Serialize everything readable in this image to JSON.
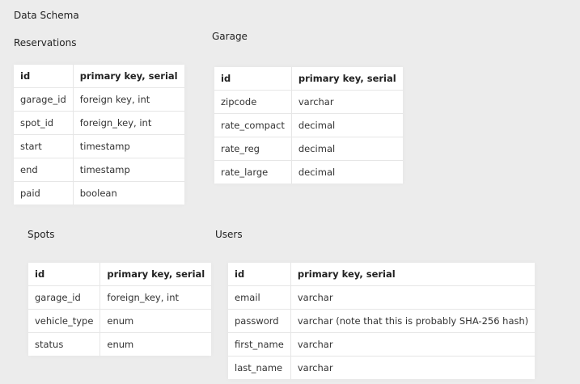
{
  "page_title": "Data Schema",
  "tables": {
    "reservations": {
      "title": "Reservations",
      "header": [
        "id",
        "primary key, serial"
      ],
      "rows": [
        [
          "garage_id",
          "foreign key, int"
        ],
        [
          "spot_id",
          "foreign_key, int"
        ],
        [
          "start",
          "timestamp"
        ],
        [
          "end",
          "timestamp"
        ],
        [
          "paid",
          "boolean"
        ]
      ]
    },
    "garage": {
      "title": "Garage",
      "header": [
        "id",
        "primary key, serial"
      ],
      "rows": [
        [
          "zipcode",
          "varchar"
        ],
        [
          "rate_compact",
          "decimal"
        ],
        [
          "rate_reg",
          "decimal"
        ],
        [
          "rate_large",
          "decimal"
        ]
      ]
    },
    "spots": {
      "title": "Spots",
      "header": [
        "id",
        "primary key, serial"
      ],
      "rows": [
        [
          "garage_id",
          "foreign_key, int"
        ],
        [
          "vehicle_type",
          "enum"
        ],
        [
          "status",
          "enum"
        ]
      ]
    },
    "users": {
      "title": "Users",
      "header": [
        "id",
        "primary key, serial"
      ],
      "rows": [
        [
          "email",
          "varchar"
        ],
        [
          "password",
          "varchar (note that this is probably SHA-256 hash)"
        ],
        [
          "first_name",
          "varchar"
        ],
        [
          "last_name",
          "varchar"
        ]
      ]
    }
  }
}
